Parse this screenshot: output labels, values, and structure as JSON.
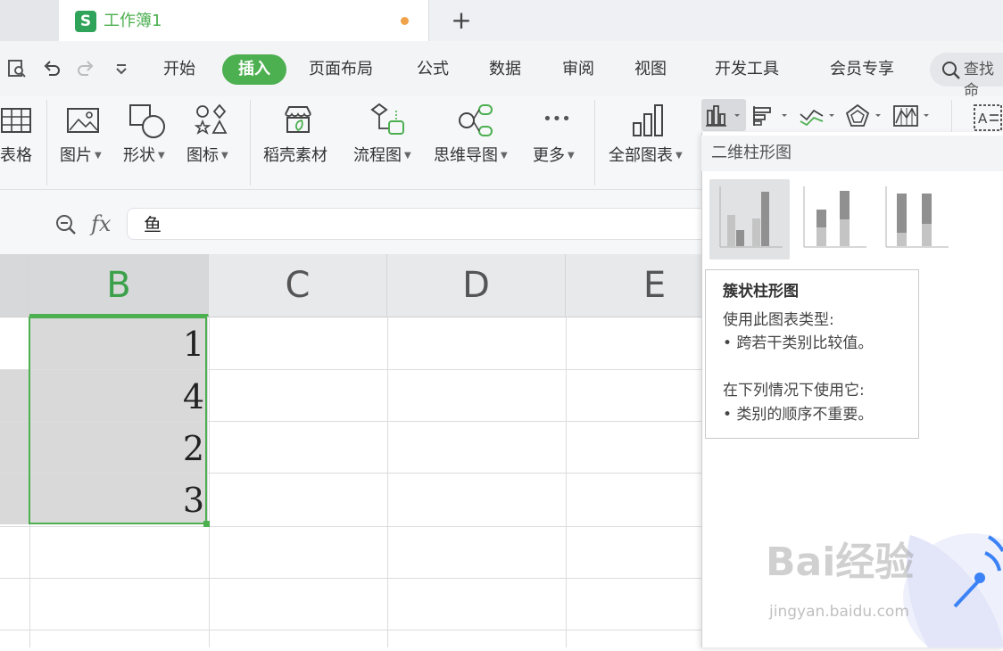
{
  "tabs": {
    "doc_icon": "S",
    "doc_title": "工作簿1",
    "new_tab": "+"
  },
  "quick_access": {
    "preview_icon": "print-preview-icon",
    "undo_icon": "undo-icon",
    "redo_icon": "redo-icon",
    "more_icon": "customize-icon"
  },
  "menu": {
    "items": [
      "开始",
      "插入",
      "页面布局",
      "公式",
      "数据",
      "审阅",
      "视图",
      "开发工具",
      "会员专享"
    ],
    "active": "插入",
    "search_label": "查找命"
  },
  "ribbon": {
    "table_label": "表格",
    "picture_label": "图片",
    "shape_label": "形状",
    "icon_label": "图标",
    "daoke_label": "稻壳素材",
    "flow_label": "流程图",
    "mind_label": "思维导图",
    "more_label": "更多",
    "allcharts_label": "全部图表",
    "more_dots": "•••"
  },
  "formula_bar": {
    "zoom_icon": "zoom-icon",
    "fx": "fx",
    "value": "鱼"
  },
  "grid": {
    "columns": [
      "B",
      "C",
      "D",
      "E"
    ],
    "selected_column": "B",
    "values": [
      "1",
      "4",
      "2",
      "3"
    ]
  },
  "dropdown": {
    "title": "二维柱形图",
    "tooltip": {
      "title": "簇状柱形图",
      "line1": "使用此图表类型:",
      "line2": "• 跨若干类别比较值。",
      "line3": "在下列情况下使用它:",
      "line4": "• 类别的顺序不重要。"
    }
  },
  "watermark": {
    "text": "Bai经验",
    "url": "jingyan.baidu.com"
  },
  "colors": {
    "accent": "#4caf50",
    "dot": "#f0a24a",
    "bar_dark": "#909090",
    "bar_light": "#c4c4c4"
  }
}
